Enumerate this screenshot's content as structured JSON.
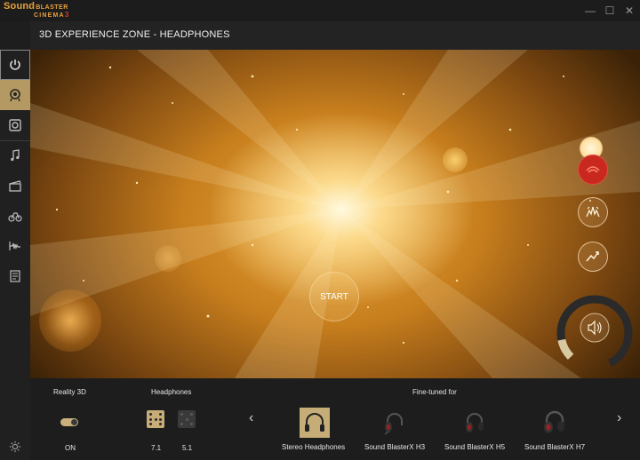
{
  "app": {
    "logo_line1": "Sound",
    "logo_line1_small": "BLASTER",
    "logo_line2": "CINEMA",
    "logo_line2_num": "3"
  },
  "window": {
    "minimize": "—",
    "maximize": "☐",
    "close": "✕"
  },
  "header": {
    "title": "3D EXPERIENCE ZONE - HEADPHONES"
  },
  "sidebar": {
    "items": [
      {
        "icon": "power-icon"
      },
      {
        "icon": "3d-experience-icon",
        "active": true
      },
      {
        "icon": "speaker-icon"
      },
      {
        "icon": "music-note-icon"
      },
      {
        "icon": "clapperboard-icon"
      },
      {
        "icon": "bike-icon"
      },
      {
        "icon": "voice-waveform-icon"
      },
      {
        "icon": "notes-icon"
      }
    ],
    "settings_icon": "gear-icon"
  },
  "visual": {
    "start_label": "START",
    "effects": [
      "surround-effect-icon",
      "crystalizer-icon",
      "dialog-plus-icon"
    ],
    "volume_icon": "speaker-volume-icon"
  },
  "bottom": {
    "reality3d_label": "Reality 3D",
    "reality3d_state": "ON",
    "headphones_label": "Headphones",
    "channel_71": "7.1",
    "channel_51": "5.1",
    "finetuned_label": "Fine-tuned for",
    "prev_arrow": "‹",
    "next_arrow": "›",
    "devices": [
      {
        "name": "Stereo Headphones",
        "selected": true
      },
      {
        "name": "Sound BlasterX H3"
      },
      {
        "name": "Sound BlasterX H5"
      },
      {
        "name": "Sound BlasterX H7"
      }
    ]
  },
  "colors": {
    "accent": "#c6ad78",
    "brand": "#e8a23a",
    "active_red": "#c8281e"
  }
}
